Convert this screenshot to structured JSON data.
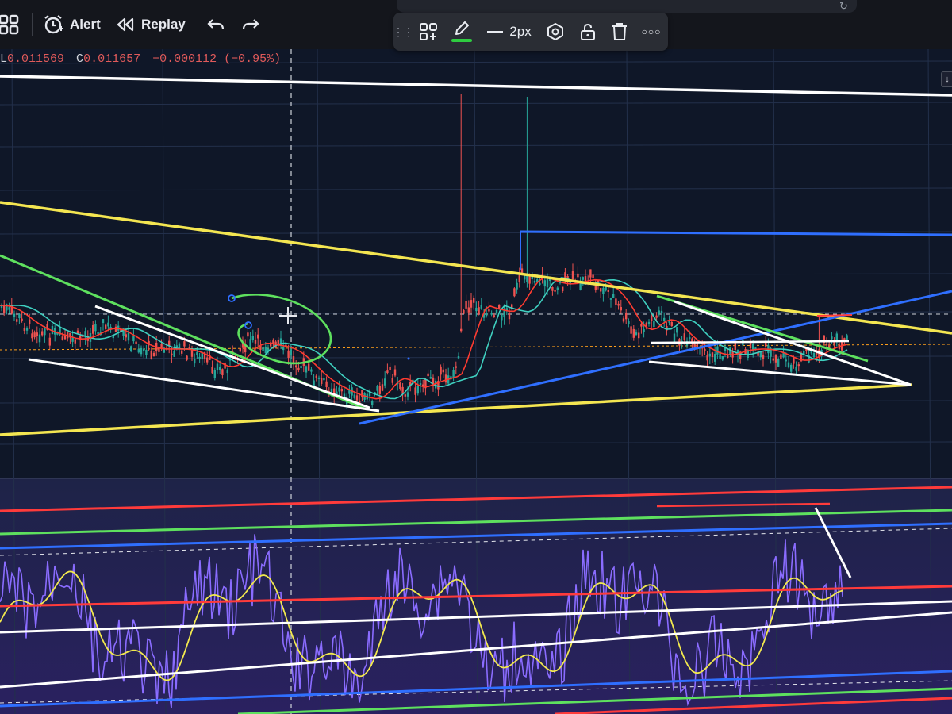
{
  "toolbar": {
    "layout_icon": "four-squares-icon",
    "alert_label": "Alert",
    "replay_label": "Replay",
    "undo_icon": "undo-arrow-icon",
    "redo_icon": "redo-arrow-icon"
  },
  "drawing_toolbar": {
    "drag_handle_icon": "drag-dots-icon",
    "template_icon": "add-template-icon",
    "brush_icon": "pencil-icon",
    "line_width_label": "2px",
    "settings_icon": "hexagon-settings-icon",
    "lock_icon": "unlock-icon",
    "delete_icon": "trash-icon",
    "more_icon": "more-dots-icon",
    "active_color": "#2ecc40"
  },
  "ohlc": {
    "low_key": "L",
    "low_value": "0.011569",
    "close_key": "C",
    "close_value": "0.011657",
    "change": "−0.000112 (−0.95%)"
  },
  "scroll_icon": "arrow-down-icon",
  "colors": {
    "background": "#0f1728",
    "indicator_background": "#241f4f",
    "grid": "#23304b",
    "up_candle": "#26a69a",
    "down_candle": "#ef5350",
    "ma_fast": "#ff3b30",
    "ma_slow": "#3fd0c0",
    "oscillator": "#8a6cff",
    "oscillator_signal": "#f2e94e",
    "trend_yellow": "#f4e651",
    "trend_white": "#ffffff",
    "trend_green": "#5ee05e",
    "trend_blue": "#2f6fff",
    "trend_red": "#ff3b3b"
  }
}
